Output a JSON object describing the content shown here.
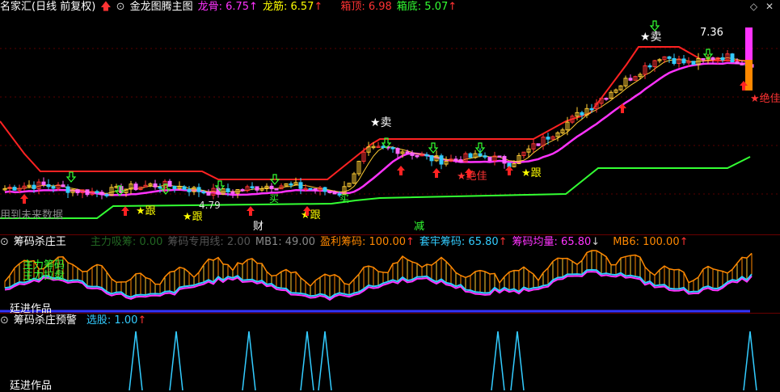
{
  "title": "名家汇(日线 前复权)",
  "main_label": "金龙图腾主图",
  "indicators_top": [
    {
      "label": "龙骨: 6.75",
      "color": "#ff33ff"
    },
    {
      "label": "龙筋: 6.57",
      "color": "#ffff00"
    },
    {
      "label": "箱顶: 6.98",
      "color": "#ff3333"
    },
    {
      "label": "箱底: 5.07",
      "color": "#33ff33"
    }
  ],
  "chart_labels": {
    "sell1": "★卖",
    "sell2": "★卖",
    "best1": "★绝佳",
    "best2": "★绝佳",
    "follow1": "★跟",
    "follow2": "★跟",
    "follow3": "★跟",
    "follow4": "★跟",
    "buy1": "买",
    "buy2": "买",
    "price_high": "7.36",
    "price_low": "4.79",
    "future": "用到未来数据",
    "cai": "财",
    "jian": "减"
  },
  "panel2": {
    "title": "筹码杀庄王",
    "items": [
      {
        "label": "主力吸筹: 0.00",
        "color": "#006600"
      },
      {
        "label": "筹码专用线: 2.00",
        "color": "#555555"
      },
      {
        "label": "MB1: 49.00",
        "color": "#888888"
      },
      {
        "label": "盈利筹码: 100.00",
        "color": "#ff8800"
      },
      {
        "label": "套牢筹码: 65.80",
        "color": "#33ccff"
      },
      {
        "label": "筹码均量: 65.80",
        "color": "#ff33ff"
      },
      {
        "label": "MB6: 100.00",
        "color": "#ff8800"
      }
    ],
    "overlay": "主力筹码",
    "overlay2": "主力拉盘",
    "watermark": "廷进作品"
  },
  "panel3": {
    "title": "筹码杀庄预警",
    "item": "选股: 1.00",
    "watermark": "廷进作品"
  },
  "chart_data": {
    "type": "line",
    "series": [
      {
        "name": "龙骨",
        "y": [
          5.1,
          5.2,
          5.3,
          5.7,
          6.2,
          6.75
        ]
      },
      {
        "name": "箱顶",
        "y": [
          6.98
        ]
      },
      {
        "name": "箱底",
        "y": [
          5.07
        ]
      },
      {
        "name": "盈利筹码",
        "y": [
          100
        ]
      },
      {
        "name": "套牢筹码",
        "y": [
          65.8
        ]
      },
      {
        "name": "筹码均量",
        "y": [
          65.8
        ]
      },
      {
        "name": "MB1",
        "y": [
          49
        ]
      },
      {
        "name": "MB6",
        "y": [
          100
        ]
      },
      {
        "name": "选股",
        "y": [
          1
        ]
      }
    ],
    "price_high": 7.36,
    "price_low": 4.79
  }
}
